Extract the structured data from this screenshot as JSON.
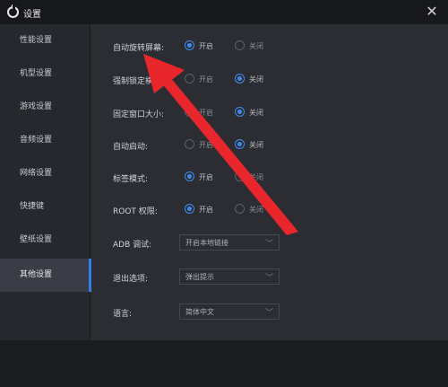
{
  "window": {
    "title": "设置"
  },
  "sidebar": {
    "items": [
      {
        "label": "性能设置"
      },
      {
        "label": "机型设置"
      },
      {
        "label": "游戏设置"
      },
      {
        "label": "音频设置"
      },
      {
        "label": "网络设置"
      },
      {
        "label": "快捷键"
      },
      {
        "label": "壁纸设置"
      },
      {
        "label": "其他设置",
        "active": true
      }
    ]
  },
  "settings": {
    "auto_rotate": {
      "label": "自动旋转屏幕:",
      "on_label": "开启",
      "off_label": "关闭",
      "selected": "on"
    },
    "force_lock": {
      "label": "强制锁定横屏:",
      "on_label": "开启",
      "off_label": "关闭",
      "selected": "off"
    },
    "fixed_window": {
      "label": "固定窗口大小:",
      "on_label": "开启",
      "off_label": "关闭",
      "selected": "off"
    },
    "auto_start": {
      "label": "自动启动:",
      "on_label": "开启",
      "off_label": "关闭",
      "selected": "off"
    },
    "tab_mode": {
      "label": "标签模式:",
      "on_label": "开启",
      "off_label": "关闭",
      "selected": "on"
    },
    "root": {
      "label": "ROOT 权限:",
      "on_label": "开启",
      "off_label": "关闭",
      "selected": "on"
    },
    "adb": {
      "label": "ADB 调试:",
      "value": "开启本地链接"
    },
    "exit_option": {
      "label": "退出选项:",
      "value": "弹出提示"
    },
    "language": {
      "label": "语言:",
      "value": "简体中文"
    }
  },
  "annotation": {
    "color": "#e8262b"
  },
  "colors": {
    "accent": "#3f8cf0",
    "background": "#2b2d33",
    "sidebar": "#26282d"
  }
}
